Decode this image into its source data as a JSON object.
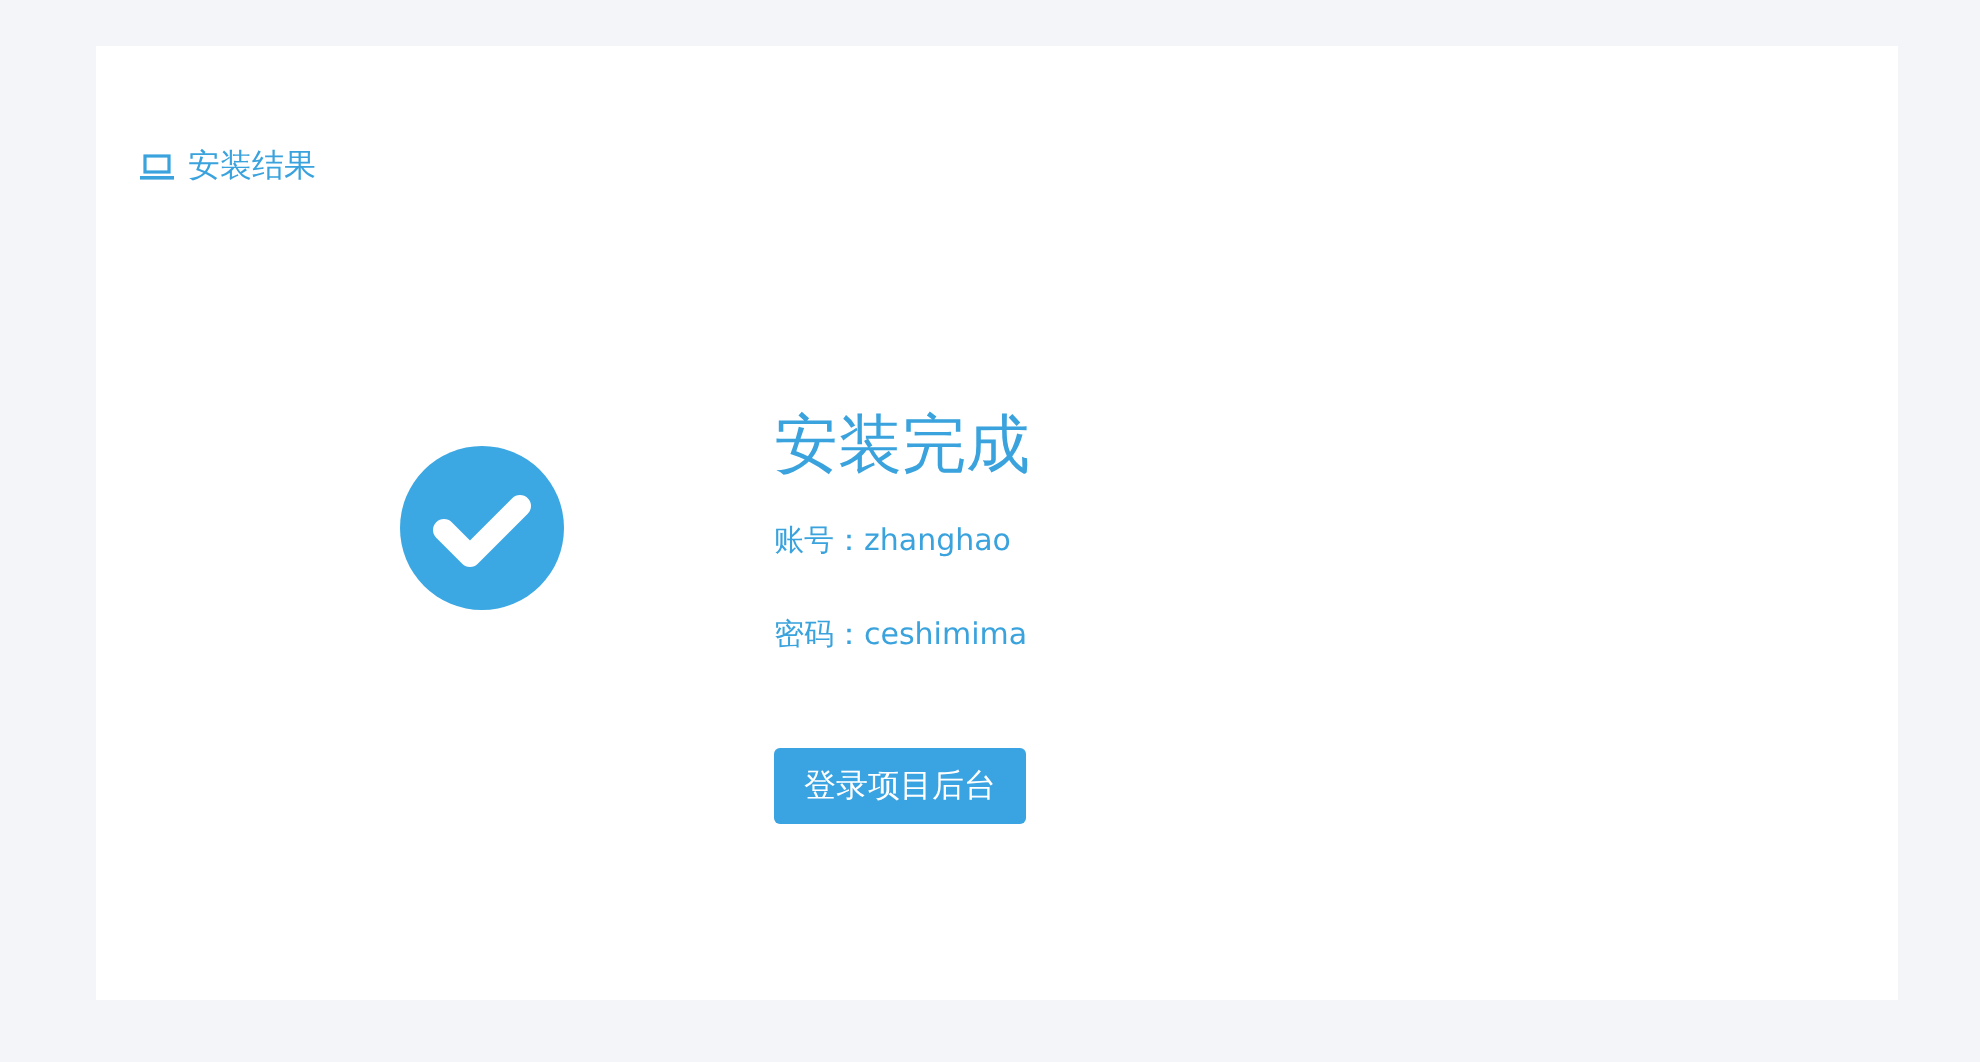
{
  "header": {
    "title": "安装结果"
  },
  "result": {
    "title": "安装完成",
    "details": [
      "账号：zhanghao",
      "密码：ceshimima"
    ],
    "button": "登录项目后台"
  }
}
